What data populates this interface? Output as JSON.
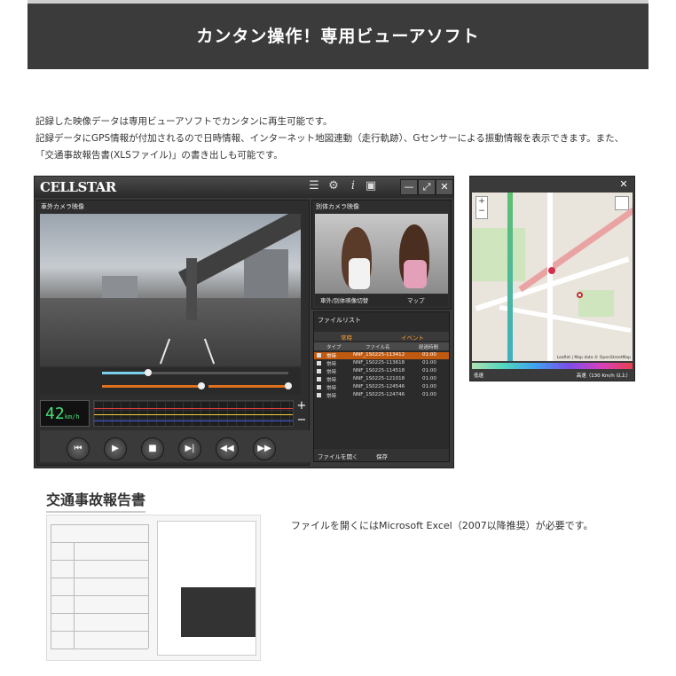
{
  "banner": {
    "title": "カンタン操作！専用ビューアソフト"
  },
  "intro": {
    "line1": "記録した映像データは専用ビューアソフトでカンタンに再生可能です。",
    "line2": "記録データにGPS情報が付加されるので日時情報、インターネット地図連動（走行軌跡）、Gセンサーによる振動情報を表示できます。また、",
    "line3": "「交通事故報告書(XLSファイル)」の書き出しも可能です。"
  },
  "viewer": {
    "logo": "CELLSTAR",
    "icons": [
      "list-icon",
      "gear-icon",
      "info-icon",
      "camera-icon"
    ],
    "window_buttons": {
      "minimize": "—",
      "maximize": "⤢",
      "close": "✕"
    },
    "main_video_label": "車外カメラ映像",
    "sub_video_label": "別体カメラ映像",
    "speed_value": "42",
    "speed_unit": "km/h",
    "sub_buttons": {
      "switch": "車外/別体映像切替",
      "map": "マップ"
    },
    "file_list": {
      "title": "ファイルリスト",
      "tab_normal": "常時",
      "tab_event": "イベント",
      "headers": {
        "type": "タイプ",
        "name": "ファイル名",
        "time": "経過時間"
      },
      "rows": [
        {
          "type": "常時",
          "name": "NNF_1S0225-113412",
          "time": "01:00"
        },
        {
          "type": "常時",
          "name": "NNF_1S0225-113618",
          "time": "01:00"
        },
        {
          "type": "常時",
          "name": "NNF_1S0225-114518",
          "time": "01:00"
        },
        {
          "type": "常時",
          "name": "NNF_1S0225-121018",
          "time": "01:00"
        },
        {
          "type": "常時",
          "name": "NNF_1S0225-124546",
          "time": "01:00"
        },
        {
          "type": "常時",
          "name": "NNF_1S0225-124746",
          "time": "01:00"
        }
      ],
      "open_button": "ファイルを開く",
      "save_button": "保存"
    },
    "controls": [
      "skip-start-icon",
      "play-icon",
      "stop-icon",
      "step-forward-icon",
      "rewind-icon",
      "fast-forward-icon"
    ]
  },
  "map_window": {
    "close": "✕",
    "zoom_in": "+",
    "zoom_out": "−",
    "legend_left": "低速",
    "legend_right": "高速（130 Km/h 以上）",
    "attribution": "Leaflet | Map data © OpenStreetMap"
  },
  "report_section": {
    "title": "交通事故報告書",
    "note": "ファイルを開くにはMicrosoft Excel（2007以降推奨）が必要です。"
  }
}
